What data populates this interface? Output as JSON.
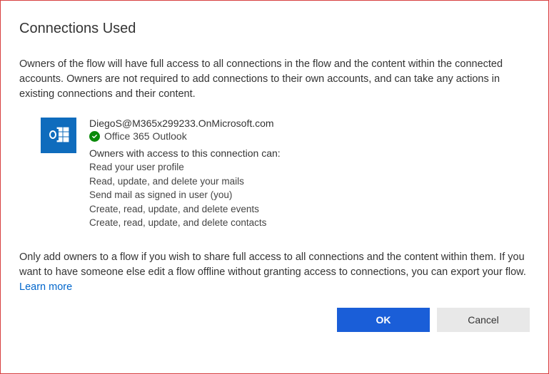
{
  "title": "Connections Used",
  "description": "Owners of the flow will have full access to all connections in the flow and the content within the connected accounts. Owners are not required to add connections to their own accounts, and can take any actions in existing connections and their content.",
  "connection": {
    "email": "DiegoS@M365x299233.OnMicrosoft.com",
    "service": "Office 365 Outlook",
    "permissions_header": "Owners with access to this connection can:",
    "permissions": [
      "Read your user profile",
      "Read, update, and delete your mails",
      "Send mail as signed in user (you)",
      "Create, read, update, and delete events",
      "Create, read, update, and delete contacts"
    ]
  },
  "footer": {
    "text": "Only add owners to a flow if you wish to share full access to all connections and the content within them. If you want to have someone else edit a flow offline without granting access to connections, you can export your flow. ",
    "link": "Learn more"
  },
  "buttons": {
    "ok": "OK",
    "cancel": "Cancel"
  },
  "colors": {
    "primary": "#1a5ed8",
    "icon_bg": "#0f6cbd",
    "success": "#0a8a0a",
    "link": "#0066cc",
    "border": "#d84040"
  }
}
